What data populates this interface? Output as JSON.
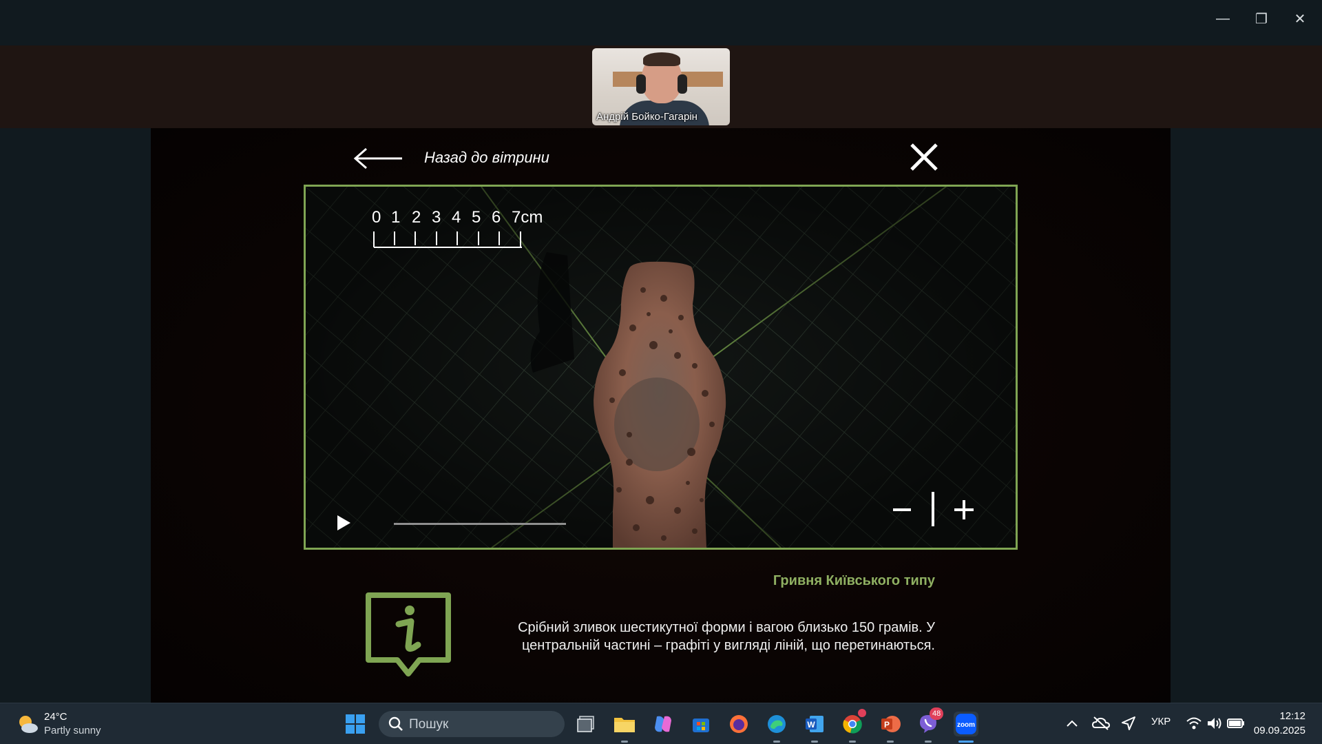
{
  "window": {
    "minimize_glyph": "—",
    "restore_glyph": "❐",
    "close_glyph": "✕"
  },
  "participant": {
    "name": "Андрій Бойко-Гагарін"
  },
  "viewer_page": {
    "back_label": "Назад до вітрини",
    "ruler_labels": [
      "0",
      "1",
      "2",
      "3",
      "4",
      "5",
      "6",
      "7cm"
    ],
    "exhibit_title": "Гривня Київського типу",
    "description": "Срібний зливок шестикутної форми і вагою близько 150 грамів. У центральній частині – графіті у вигляді ліній, що перетинаються.",
    "accent_color": "#7fa553",
    "video_progress": 0.0
  },
  "taskbar": {
    "weather": {
      "temp": "24°C",
      "desc": "Partly sunny",
      "icon": "partly-sunny-icon"
    },
    "search_placeholder": "Пошук",
    "apps": [
      {
        "name": "start",
        "icon": "windows-icon"
      },
      {
        "name": "task-view",
        "icon": "task-view-icon"
      },
      {
        "name": "file-explorer",
        "icon": "folder-icon"
      },
      {
        "name": "copilot",
        "icon": "copilot-icon"
      },
      {
        "name": "microsoft-store",
        "icon": "store-icon"
      },
      {
        "name": "firefox",
        "icon": "firefox-icon"
      },
      {
        "name": "edge",
        "icon": "edge-icon"
      },
      {
        "name": "word",
        "icon": "word-icon",
        "letter": "W"
      },
      {
        "name": "chrome",
        "icon": "chrome-icon"
      },
      {
        "name": "powerpoint",
        "icon": "powerpoint-icon",
        "letter": "P"
      },
      {
        "name": "viber",
        "icon": "viber-icon",
        "badge": "48"
      },
      {
        "name": "zoom",
        "icon": "zoom-icon",
        "letter": "zoom"
      }
    ],
    "tray": {
      "language": "УКР",
      "time": "12:12",
      "date": "09.09.2025"
    }
  }
}
